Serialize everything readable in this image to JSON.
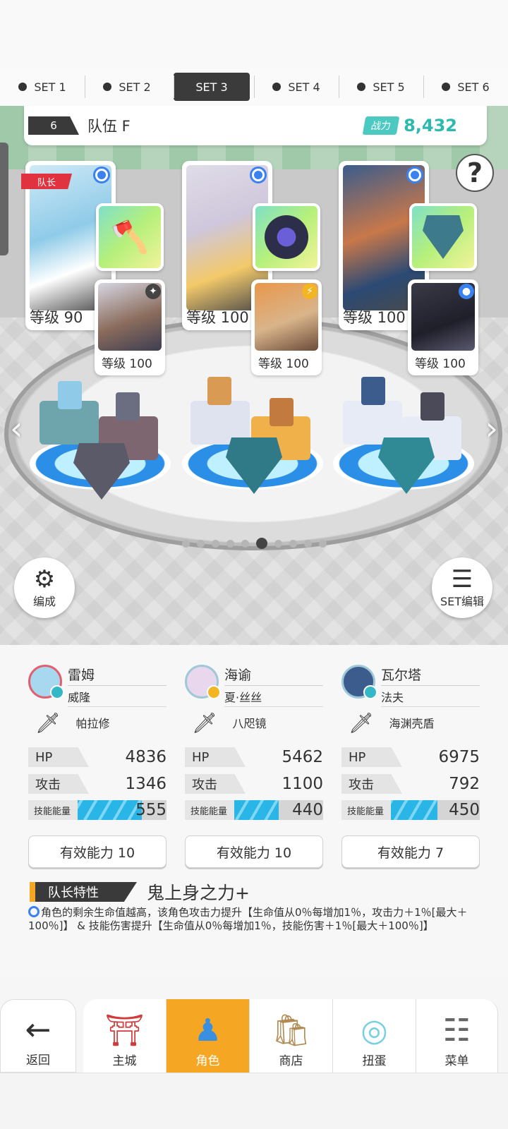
{
  "set_tabs": [
    {
      "label": "SET 1",
      "active": false
    },
    {
      "label": "SET 2",
      "active": false
    },
    {
      "label": "SET 3",
      "active": true
    },
    {
      "label": "SET 4",
      "active": false
    },
    {
      "label": "SET 5",
      "active": false
    },
    {
      "label": "SET 6",
      "active": false
    }
  ],
  "team": {
    "number": "6",
    "name": "队伍 F",
    "power_label": "战力",
    "power_value": "8,432"
  },
  "leader_tag": "队长",
  "help_icon": "?",
  "characters": [
    {
      "level": "等级 90",
      "sub_level": "等级 100",
      "name": "雷姆",
      "class": "威隆",
      "weapon": "帕拉修",
      "hp_label": "HP",
      "hp": "4836",
      "atk_label": "攻击",
      "atk": "1346",
      "energy_label": "技能能量",
      "energy": "555",
      "energy_fill": 0.72,
      "effective": "有效能力 10",
      "accent": "#a8d8f0"
    },
    {
      "level": "等级 100",
      "sub_level": "等级 100",
      "name": "海谕",
      "class": "夏·丝丝",
      "weapon": "八咫镜",
      "hp_label": "HP",
      "hp": "5462",
      "atk_label": "攻击",
      "atk": "1100",
      "energy_label": "技能能量",
      "energy": "440",
      "energy_fill": 0.5,
      "effective": "有效能力 10",
      "accent": "#e9d7ee"
    },
    {
      "level": "等级 100",
      "sub_level": "等级 100",
      "name": "瓦尔塔",
      "class": "法夫",
      "weapon": "海渊壳盾",
      "hp_label": "HP",
      "hp": "6975",
      "atk_label": "攻击",
      "atk": "792",
      "energy_label": "技能能量",
      "energy": "450",
      "energy_fill": 0.52,
      "effective": "有效能力 7",
      "accent": "#3b5c8c"
    }
  ],
  "buttons": {
    "formation": "编成",
    "set_edit": "SET编辑"
  },
  "leader_trait": {
    "label": "队长特性",
    "title": "鬼上身之力+",
    "description": "角色的剩余生命值越高，该角色攻击力提升【生命值从0％每增加1％，攻击力＋1％[最大＋100％]】 & 技能伤害提升【生命值从0％每增加1％，技能伤害＋1％[最大＋100％]】"
  },
  "nav": {
    "back": "返回",
    "items": [
      {
        "label": "主城",
        "icon": "castle-icon",
        "active": false
      },
      {
        "label": "角色",
        "icon": "character-icon",
        "active": true
      },
      {
        "label": "商店",
        "icon": "shop-icon",
        "active": false
      },
      {
        "label": "扭蛋",
        "icon": "gacha-icon",
        "active": false
      },
      {
        "label": "菜单",
        "icon": "menu-icon",
        "active": false
      }
    ]
  },
  "pager": {
    "count": 10,
    "current": 6
  },
  "colors": {
    "accent_orange": "#f5a623",
    "accent_teal": "#2eb9b0",
    "radio_blue": "#3a82f0"
  }
}
